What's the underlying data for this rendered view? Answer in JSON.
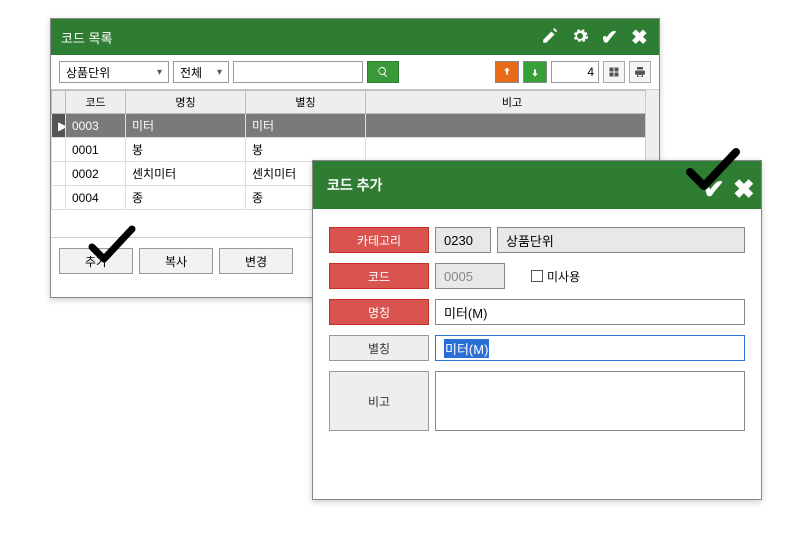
{
  "main_window": {
    "title": "코드 목록",
    "dropdown_category": "상품단위",
    "dropdown_filter": "전체",
    "search_value": "",
    "count": "4",
    "columns": {
      "code": "코드",
      "name": "명칭",
      "alias": "별칭",
      "remark": "비고"
    },
    "rows": [
      {
        "code": "0003",
        "name": "미터",
        "alias": "미터",
        "remark": ""
      },
      {
        "code": "0001",
        "name": "봉",
        "alias": "봉",
        "remark": ""
      },
      {
        "code": "0002",
        "name": "센치미터",
        "alias": "센치미터",
        "remark": ""
      },
      {
        "code": "0004",
        "name": "종",
        "alias": "종",
        "remark": ""
      }
    ],
    "buttons": {
      "add": "추가",
      "copy": "복사",
      "modify": "변경"
    }
  },
  "dialog": {
    "title": "코드 추가",
    "fields": {
      "category_label": "카테고리",
      "category_code": "0230",
      "category_name": "상품단위",
      "code_label": "코드",
      "code_value": "0005",
      "unused_label": "미사용",
      "name_label": "명칭",
      "name_value": "미터(M)",
      "alias_label": "별칭",
      "alias_value": "미터(M)",
      "remark_label": "비고",
      "remark_value": ""
    }
  }
}
